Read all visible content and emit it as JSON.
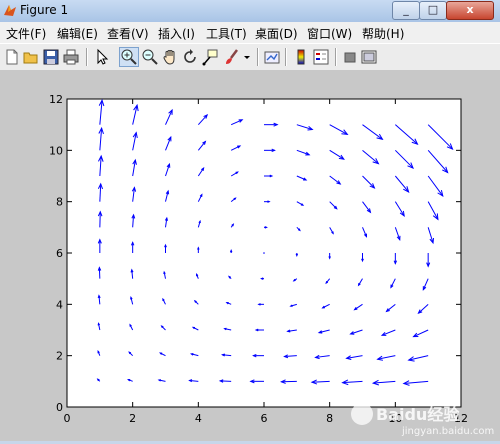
{
  "window": {
    "title": "Figure 1",
    "controls": [
      "_",
      "□",
      "x"
    ]
  },
  "menu": [
    "文件(F)",
    "编辑(E)",
    "查看(V)",
    "插入(I)",
    "工具(T)",
    "桌面(D)",
    "窗口(W)",
    "帮助(H)"
  ],
  "toolbar_icons": [
    "new-figure-icon",
    "open-file-icon",
    "save-icon",
    "print-icon",
    "select-arrow-icon",
    "zoom-in-icon",
    "zoom-out-icon",
    "pan-hand-icon",
    "rotate-3d-icon",
    "data-cursor-icon",
    "brush-icon",
    "brush-dropdown-icon",
    "link-plot-icon",
    "insert-colorbar-icon",
    "insert-legend-icon",
    "hide-plot-tools-icon",
    "show-plot-tools-icon"
  ],
  "colors": {
    "quiver": "#0000ff",
    "figure_bg": "#c8c8c8",
    "axes_bg": "#ffffff"
  },
  "watermark": {
    "main": "Baidu经验",
    "sub": "jingyan.baidu.com"
  },
  "chart_data": {
    "type": "quiver",
    "title": "",
    "xlabel": "",
    "ylabel": "",
    "xlim": [
      0,
      12
    ],
    "ylim": [
      0,
      12
    ],
    "xticks": [
      0,
      2,
      4,
      6,
      8,
      10,
      12
    ],
    "yticks": [
      0,
      2,
      4,
      6,
      8,
      10,
      12
    ],
    "grid": [
      1,
      11,
      1
    ],
    "field": {
      "u": "x*(y-6)",
      "v": "-y*(x-6)",
      "note_scale": "auto"
    },
    "grid_on": false
  }
}
